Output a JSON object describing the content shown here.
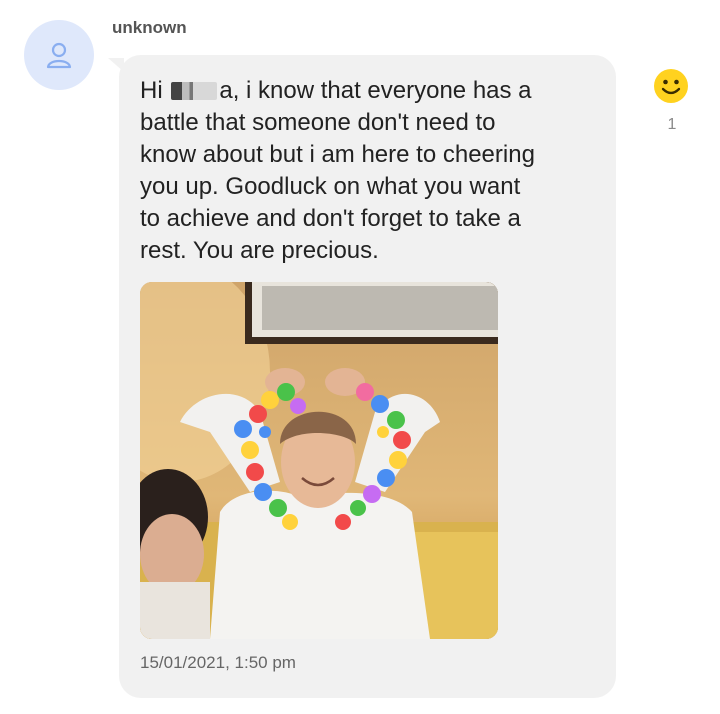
{
  "sender": {
    "name": "unknown"
  },
  "message": {
    "text_before_redaction": "Hi ",
    "text_after_redaction": "a, i know that everyone has a\nbattle that someone don't need to\nknow about but i am here to cheering\nyou up. Goodluck on what you want\nto achieve and don't forget to take a\nrest. You are precious.",
    "timestamp": "15/01/2021, 1:50 pm"
  },
  "reaction": {
    "icon": "smiley-icon",
    "count": "1",
    "color": "#ffd21f"
  },
  "colors": {
    "bubble": "#f1f1f1",
    "avatar_bg": "#dfe8fb",
    "avatar_icon": "#8aaef0"
  }
}
